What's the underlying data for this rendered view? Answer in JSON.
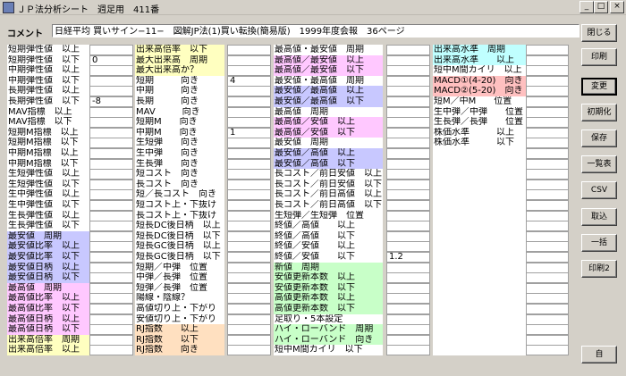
{
  "window": {
    "title": "ＪＰ法分析シート　週足用　411番",
    "min_glyph": "_",
    "max_glyph": "□",
    "close_glyph": "×"
  },
  "comment": {
    "label": "コメント",
    "value": "日経平均 買いサイン−11−　図解JP法(1)買い転換(簡易版)　1999年度会報　36ページ"
  },
  "columns": [
    {
      "id": "col1",
      "rows": [
        {
          "label": "短期弾性値　以上",
          "value": "",
          "color": "w"
        },
        {
          "label": "短期弾性値　以下",
          "value": "0",
          "color": "w"
        },
        {
          "label": "中期弾性値　以上",
          "value": "",
          "color": "w"
        },
        {
          "label": "中期弾性値　以下",
          "value": "",
          "color": "w"
        },
        {
          "label": "長期弾性値　以上",
          "value": "",
          "color": "w"
        },
        {
          "label": "長期弾性値　以下",
          "value": "-8",
          "color": "w"
        },
        {
          "label": "MAV指標　以上",
          "value": "",
          "color": "w"
        },
        {
          "label": "MAV指標　以下",
          "value": "",
          "color": "w"
        },
        {
          "label": "短期M指標　以上",
          "value": "",
          "color": "w"
        },
        {
          "label": "短期M指標　以下",
          "value": "",
          "color": "w"
        },
        {
          "label": "中期M指標　以上",
          "value": "",
          "color": "w"
        },
        {
          "label": "中期M指標　以下",
          "value": "",
          "color": "w"
        },
        {
          "label": "生短弾性値　以上",
          "value": "",
          "color": "w"
        },
        {
          "label": "生短弾性値　以下",
          "value": "",
          "color": "w"
        },
        {
          "label": "生中弾性値　以上",
          "value": "",
          "color": "w"
        },
        {
          "label": "生中弾性値　以下",
          "value": "",
          "color": "w"
        },
        {
          "label": "生長弾性値　以上",
          "value": "",
          "color": "w"
        },
        {
          "label": "生長弾性値　以下",
          "value": "",
          "color": "w"
        },
        {
          "label": "最安値　周期",
          "value": "",
          "color": "l"
        },
        {
          "label": "最安値比率　以上",
          "value": "",
          "color": "l"
        },
        {
          "label": "最安値比率　以下",
          "value": "",
          "color": "l"
        },
        {
          "label": "最安値日柄　以上",
          "value": "",
          "color": "l"
        },
        {
          "label": "最安値日柄　以下",
          "value": "",
          "color": "l"
        },
        {
          "label": "最高値　周期",
          "value": "",
          "color": "p"
        },
        {
          "label": "最高値比率　以上",
          "value": "",
          "color": "p"
        },
        {
          "label": "最高値比率　以下",
          "value": "",
          "color": "p"
        },
        {
          "label": "最高値日柄　以上",
          "value": "",
          "color": "p"
        },
        {
          "label": "最高値日柄　以下",
          "value": "",
          "color": "p"
        },
        {
          "label": "出来高倍率　周期",
          "value": "",
          "color": "y"
        },
        {
          "label": "出来高倍率　以上",
          "value": "",
          "color": "y"
        }
      ]
    },
    {
      "id": "col2",
      "rows": [
        {
          "label": "出来高倍率　以下",
          "value": "",
          "color": "y"
        },
        {
          "label": "最大出来高　周期",
          "value": "",
          "color": "y"
        },
        {
          "label": "最大出来高か？",
          "value": "",
          "color": "y"
        },
        {
          "label": "短期　　　向き",
          "value": "4",
          "color": "w"
        },
        {
          "label": "中期　　　向き",
          "value": "",
          "color": "w"
        },
        {
          "label": "長期　　　向き",
          "value": "",
          "color": "w"
        },
        {
          "label": "MAV　　　向き",
          "value": "",
          "color": "w"
        },
        {
          "label": "短期M　　向き",
          "value": "",
          "color": "w"
        },
        {
          "label": "中期M　　向き",
          "value": "1",
          "color": "w"
        },
        {
          "label": "生短弾　　向き",
          "value": "",
          "color": "w"
        },
        {
          "label": "生中弾　　向き",
          "value": "",
          "color": "w"
        },
        {
          "label": "生長弾　　向き",
          "value": "",
          "color": "w"
        },
        {
          "label": "短コスト　向き",
          "value": "",
          "color": "w"
        },
        {
          "label": "長コスト　向き",
          "value": "",
          "color": "w"
        },
        {
          "label": "短／長コスト　向き",
          "value": "",
          "color": "w"
        },
        {
          "label": "短コスト上・下抜け",
          "value": "",
          "color": "w"
        },
        {
          "label": "長コスト上・下抜け",
          "value": "",
          "color": "w"
        },
        {
          "label": "短長DC後日柄　以上",
          "value": "",
          "color": "w"
        },
        {
          "label": "短長DC後日柄　以下",
          "value": "",
          "color": "w"
        },
        {
          "label": "短長GC後日柄　以上",
          "value": "",
          "color": "w"
        },
        {
          "label": "短長GC後日柄　以下",
          "value": "",
          "color": "w"
        },
        {
          "label": "短期／中弾　位置",
          "value": "",
          "color": "w"
        },
        {
          "label": "中弾／長弾　位置",
          "value": "",
          "color": "w"
        },
        {
          "label": "短弾／長弾　位置",
          "value": "",
          "color": "w"
        },
        {
          "label": "陽線・陰線？",
          "value": "",
          "color": "w"
        },
        {
          "label": "高値切り上・下がり",
          "value": "",
          "color": "w"
        },
        {
          "label": "安値切り上・下がり",
          "value": "",
          "color": "w"
        },
        {
          "label": "RJ指数　　以上",
          "value": "",
          "color": "o"
        },
        {
          "label": "RJ指数　　以下",
          "value": "",
          "color": "o"
        },
        {
          "label": "RJ指数　　向き",
          "value": "",
          "color": "o"
        }
      ]
    },
    {
      "id": "col3",
      "rows": [
        {
          "label": "最高値・最安値　周期",
          "value": "",
          "color": "w"
        },
        {
          "label": "最高値／最安値　以上",
          "value": "",
          "color": "p"
        },
        {
          "label": "最高値／最安値　以下",
          "value": "",
          "color": "p"
        },
        {
          "label": "最安値・最高値　周期",
          "value": "",
          "color": "w"
        },
        {
          "label": "最安値／最高値　以上",
          "value": "",
          "color": "l"
        },
        {
          "label": "最安値／最高値　以下",
          "value": "",
          "color": "l"
        },
        {
          "label": "最高値　周期",
          "value": "",
          "color": "w"
        },
        {
          "label": "最高値／安値　以上",
          "value": "",
          "color": "p"
        },
        {
          "label": "最高値／安値　以下",
          "value": "",
          "color": "p"
        },
        {
          "label": "最安値　周期",
          "value": "",
          "color": "w"
        },
        {
          "label": "最安値／高値　以上",
          "value": "",
          "color": "l"
        },
        {
          "label": "最安値／高値　以下",
          "value": "",
          "color": "l"
        },
        {
          "label": "長コスト／前日安値　以上",
          "value": "",
          "color": "w"
        },
        {
          "label": "長コスト／前日安値　以下",
          "value": "",
          "color": "w"
        },
        {
          "label": "長コスト／前日高値　以上",
          "value": "",
          "color": "w"
        },
        {
          "label": "長コスト／前日高値　以下",
          "value": "",
          "color": "w"
        },
        {
          "label": "生短弾／生短弾　位置",
          "value": "",
          "color": "w"
        },
        {
          "label": "終値／高値　　以上",
          "value": "",
          "color": "w"
        },
        {
          "label": "終値／高値　　以下",
          "value": "",
          "color": "w"
        },
        {
          "label": "終値／安値　　以上",
          "value": "",
          "color": "w"
        },
        {
          "label": "終値／安値　　以下",
          "value": "1.2",
          "color": "w"
        },
        {
          "label": "新値　周期",
          "value": "",
          "color": "g"
        },
        {
          "label": "安値更新本数　以上",
          "value": "",
          "color": "g"
        },
        {
          "label": "安値更新本数　以下",
          "value": "",
          "color": "g"
        },
        {
          "label": "高値更新本数　以上",
          "value": "",
          "color": "g"
        },
        {
          "label": "高値更新本数　以下",
          "value": "",
          "color": "g"
        },
        {
          "label": "足取り・5本設定",
          "value": "",
          "color": "w"
        },
        {
          "label": "ハイ・ローバンド　周期",
          "value": "",
          "color": "g"
        },
        {
          "label": "ハイ・ローバンド　向き",
          "value": "",
          "color": "g"
        },
        {
          "label": "短中M間カイリ　以下",
          "value": "",
          "color": "w"
        }
      ]
    },
    {
      "id": "col4",
      "rows": [
        {
          "label": "出来高水準　周期",
          "value": "",
          "color": "c"
        },
        {
          "label": "出来高水準　　以上",
          "value": "",
          "color": "c"
        },
        {
          "label": "短中M間カイリ　以上",
          "value": "",
          "color": "w"
        },
        {
          "label": "MACD①(4-20)　向き",
          "value": "",
          "color": "r"
        },
        {
          "label": "MACD②(5-20)　向き",
          "value": "",
          "color": "r"
        },
        {
          "label": "短M／中M　　位置",
          "value": "",
          "color": "w"
        },
        {
          "label": "生中弾／中弾　　位置",
          "value": "",
          "color": "w"
        },
        {
          "label": "生長弾／長弾　　位置",
          "value": "",
          "color": "w"
        },
        {
          "label": "株価水準　　　以上",
          "value": "",
          "color": "w"
        },
        {
          "label": "株価水準　　　以下",
          "value": "",
          "color": "w"
        },
        {
          "label": "",
          "value": "",
          "color": "w"
        },
        {
          "label": "",
          "value": "",
          "color": "w"
        },
        {
          "label": "",
          "value": "",
          "color": "w"
        },
        {
          "label": "",
          "value": "",
          "color": "w"
        },
        {
          "label": "",
          "value": "",
          "color": "w"
        },
        {
          "label": "",
          "value": "",
          "color": "w"
        },
        {
          "label": "",
          "value": "",
          "color": "w"
        },
        {
          "label": "",
          "value": "",
          "color": "w"
        },
        {
          "label": "",
          "value": "",
          "color": "w"
        },
        {
          "label": "",
          "value": "",
          "color": "w"
        },
        {
          "label": "",
          "value": "",
          "color": "w"
        },
        {
          "label": "",
          "value": "",
          "color": "w"
        },
        {
          "label": "",
          "value": "",
          "color": "w"
        },
        {
          "label": "",
          "value": "",
          "color": "w"
        },
        {
          "label": "",
          "value": "",
          "color": "w"
        },
        {
          "label": "",
          "value": "",
          "color": "w"
        },
        {
          "label": "",
          "value": "",
          "color": "w"
        },
        {
          "label": "",
          "value": "",
          "color": "w"
        },
        {
          "label": "",
          "value": "",
          "color": "w"
        },
        {
          "label": "",
          "value": "",
          "color": "w"
        }
      ]
    }
  ],
  "buttons": [
    {
      "name": "close-button",
      "label": "閉じる"
    },
    {
      "name": "print-button",
      "label": "印刷"
    },
    {
      "name": "change-button",
      "label": "変更"
    },
    {
      "name": "initialize-button",
      "label": "初期化"
    },
    {
      "name": "save-button",
      "label": "保存"
    },
    {
      "name": "list-button",
      "label": "一覧表"
    },
    {
      "name": "csv-button",
      "label": "CSV"
    },
    {
      "name": "import-button",
      "label": "取込"
    },
    {
      "name": "batch-button",
      "label": "一括"
    },
    {
      "name": "print2-button",
      "label": "印刷2"
    },
    {
      "name": "self-button",
      "label": "自"
    }
  ],
  "colors": {
    "w": "#ffffff",
    "y": "#ffffc0",
    "p": "#ffc8ff",
    "l": "#c8c8ff",
    "o": "#ffe0c0",
    "g": "#c8ffc8",
    "c": "#c0ffff",
    "r": "#ffc0c0"
  }
}
